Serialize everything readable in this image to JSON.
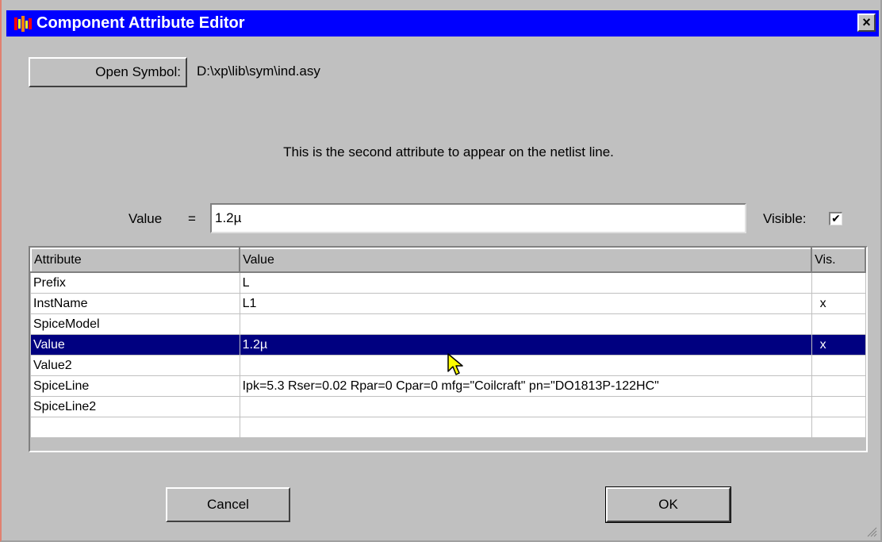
{
  "window": {
    "title": "Component Attribute Editor",
    "close_label": "×"
  },
  "open_symbol": {
    "button_label": "Open Symbol:",
    "path": "D:\\xp\\lib\\sym\\ind.asy"
  },
  "info_text": "This is the second attribute to appear on the netlist line.",
  "value_editor": {
    "label": "Value",
    "equals": "=",
    "value": "1.2µ",
    "visible_label": "Visible:",
    "visible_checked": true,
    "check_mark": "✔"
  },
  "grid": {
    "headers": [
      "Attribute",
      "Value",
      "Vis."
    ],
    "rows": [
      {
        "attribute": "Prefix",
        "value": "L",
        "vis": ""
      },
      {
        "attribute": "InstName",
        "value": "L1",
        "vis": "x"
      },
      {
        "attribute": "SpiceModel",
        "value": "",
        "vis": ""
      },
      {
        "attribute": "Value",
        "value": "1.2µ",
        "vis": "x"
      },
      {
        "attribute": "Value2",
        "value": "",
        "vis": ""
      },
      {
        "attribute": "SpiceLine",
        "value": "Ipk=5.3 Rser=0.02 Rpar=0 Cpar=0 mfg=\"Coilcraft\" pn=\"DO1813P-122HC\"",
        "vis": ""
      },
      {
        "attribute": "SpiceLine2",
        "value": "",
        "vis": ""
      },
      {
        "attribute": "",
        "value": "",
        "vis": ""
      }
    ],
    "selected_row": 3
  },
  "buttons": {
    "cancel": "Cancel",
    "ok": "OK"
  },
  "colors": {
    "titlebar": "#0000ff",
    "selection": "#000080",
    "face": "#c0c0c0"
  },
  "icons": {
    "app": "app-icon",
    "close": "close-icon",
    "cursor": "mouse-pointer-icon",
    "grip": "resize-grip-icon"
  }
}
